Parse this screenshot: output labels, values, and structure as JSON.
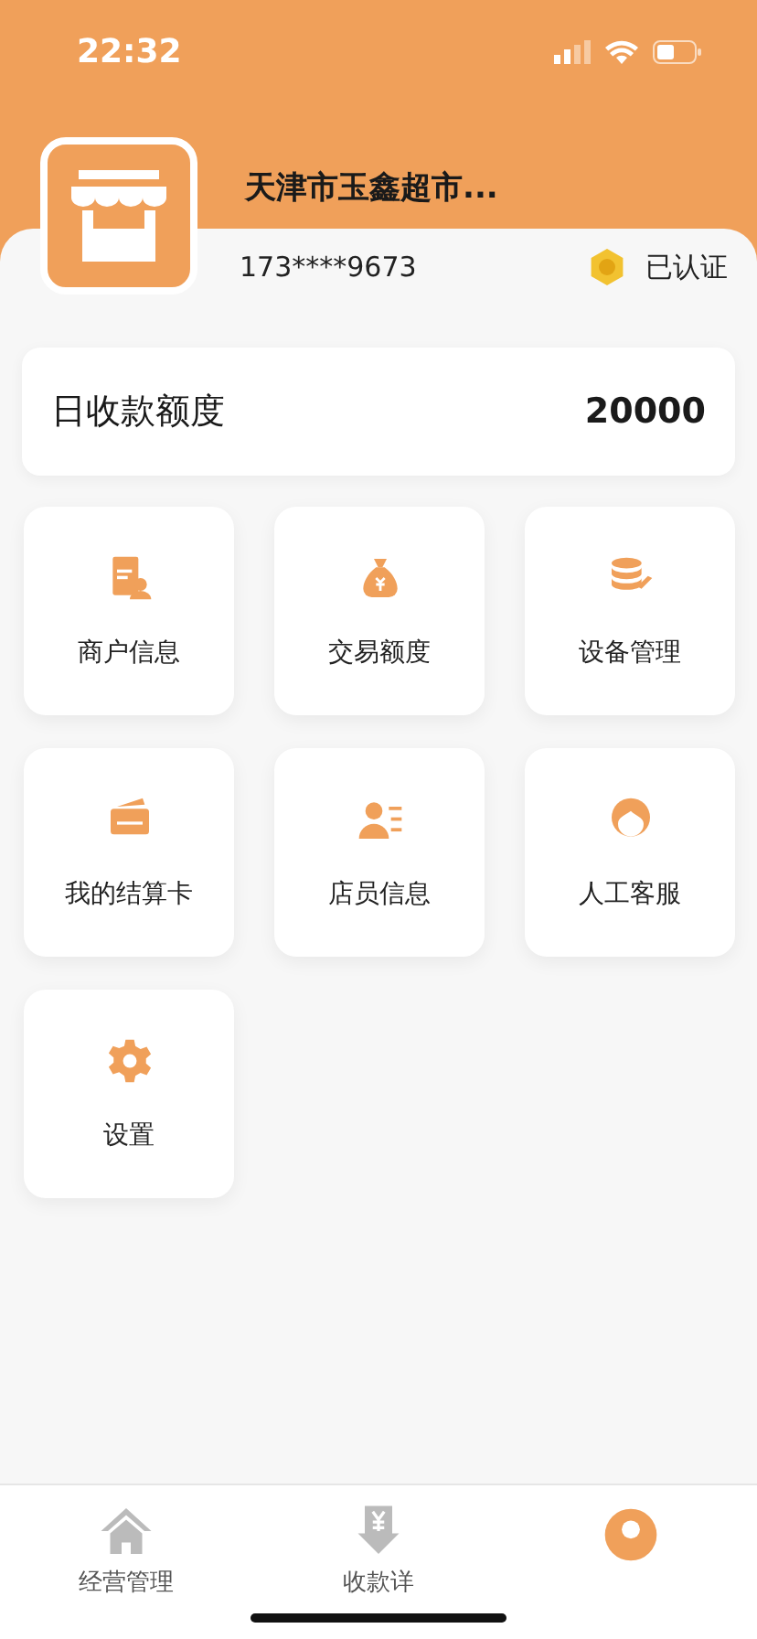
{
  "status_bar": {
    "time": "22:32"
  },
  "merchant": {
    "name": "天津市玉鑫超市...",
    "phone": "173****9673",
    "verification": "已认证"
  },
  "daily_limit": {
    "label": "日收款额度",
    "value": "20000"
  },
  "menu": [
    {
      "label": "商户信息",
      "kind": "merchant"
    },
    {
      "label": "交易额度",
      "kind": "moneybag"
    },
    {
      "label": "设备管理",
      "kind": "device"
    },
    {
      "label": "我的结算卡",
      "kind": "card"
    },
    {
      "label": "店员信息",
      "kind": "staff"
    },
    {
      "label": "人工客服",
      "kind": "service"
    },
    {
      "label": "设置",
      "kind": "gear"
    }
  ],
  "tab_bar": [
    {
      "label": "经营管理",
      "kind": "home",
      "selected": false
    },
    {
      "label": "收款详",
      "kind": "receipt",
      "selected": false
    },
    {
      "kind": "profile",
      "selected": true
    }
  ]
}
